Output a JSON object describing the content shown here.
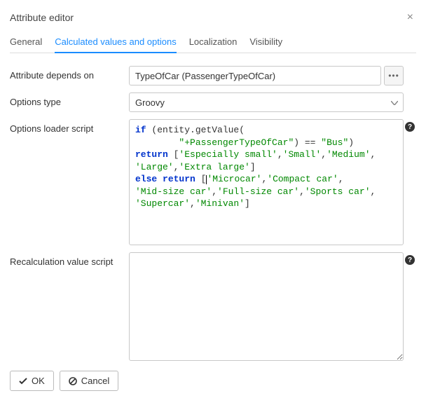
{
  "dialog": {
    "title": "Attribute editor"
  },
  "tabs": {
    "general": "General",
    "calculated": "Calculated values and options",
    "localization": "Localization",
    "visibility": "Visibility",
    "active": "calculated"
  },
  "labels": {
    "depends_on": "Attribute depends on",
    "options_type": "Options type",
    "loader_script": "Options loader script",
    "recalc_script": "Recalculation value script"
  },
  "fields": {
    "depends_on_value": "TypeOfCar (PassengerTypeOfCar)",
    "options_type_value": "Groovy",
    "recalc_value": ""
  },
  "code": {
    "tokens": [
      {
        "t": "kw",
        "v": "if"
      },
      {
        "t": "pun",
        "v": " (entity.getValue(\n        "
      },
      {
        "t": "str",
        "v": "\"+PassengerTypeOfCar\""
      },
      {
        "t": "pun",
        "v": ") == "
      },
      {
        "t": "str",
        "v": "\"Bus\""
      },
      {
        "t": "pun",
        "v": ")\n"
      },
      {
        "t": "kw",
        "v": "return"
      },
      {
        "t": "pun",
        "v": " ["
      },
      {
        "t": "str",
        "v": "'Especially small'"
      },
      {
        "t": "pun",
        "v": ","
      },
      {
        "t": "str",
        "v": "'Small'"
      },
      {
        "t": "pun",
        "v": ","
      },
      {
        "t": "str",
        "v": "'Medium'"
      },
      {
        "t": "pun",
        "v": ",\n"
      },
      {
        "t": "str",
        "v": "'Large'"
      },
      {
        "t": "pun",
        "v": ","
      },
      {
        "t": "str",
        "v": "'Extra large'"
      },
      {
        "t": "pun",
        "v": "]\n"
      },
      {
        "t": "kw",
        "v": "else"
      },
      {
        "t": "pun",
        "v": " "
      },
      {
        "t": "kw",
        "v": "return"
      },
      {
        "t": "pun",
        "v": " ["
      },
      {
        "t": "cursor",
        "v": ""
      },
      {
        "t": "str",
        "v": "'Microcar'"
      },
      {
        "t": "pun",
        "v": ","
      },
      {
        "t": "str",
        "v": "'Compact car'"
      },
      {
        "t": "pun",
        "v": ",\n"
      },
      {
        "t": "str",
        "v": "'Mid-size car'"
      },
      {
        "t": "pun",
        "v": ","
      },
      {
        "t": "str",
        "v": "'Full-size car'"
      },
      {
        "t": "pun",
        "v": ","
      },
      {
        "t": "str",
        "v": "'Sports car'"
      },
      {
        "t": "pun",
        "v": ",\n"
      },
      {
        "t": "str",
        "v": "'Supercar'"
      },
      {
        "t": "pun",
        "v": ","
      },
      {
        "t": "str",
        "v": "'Minivan'"
      },
      {
        "t": "pun",
        "v": "]"
      }
    ]
  },
  "buttons": {
    "ok": "OK",
    "cancel": "Cancel"
  }
}
